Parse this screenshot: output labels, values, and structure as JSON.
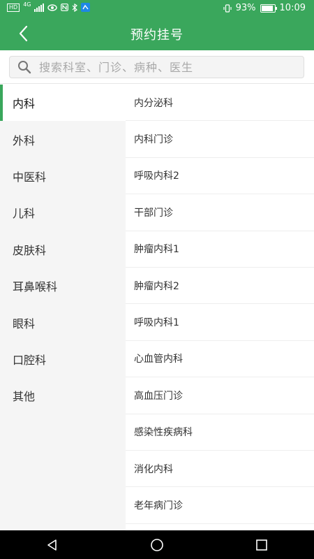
{
  "status_bar": {
    "network_badge": "HD",
    "signal_type": "4G",
    "battery_percent": "93%",
    "battery_level": 0.93,
    "time": "10:09",
    "icons": [
      "hd-icon",
      "signal-icon",
      "eye-icon",
      "nfc-icon",
      "bluetooth-icon",
      "app-icon",
      "vibrate-icon",
      "battery-icon"
    ]
  },
  "header": {
    "title": "预约挂号",
    "back_icon": "chevron-left-icon"
  },
  "search": {
    "placeholder": "搜索科室、门诊、病种、医生",
    "value": ""
  },
  "departments": [
    {
      "label": "内科",
      "active": true
    },
    {
      "label": "外科",
      "active": false
    },
    {
      "label": "中医科",
      "active": false
    },
    {
      "label": "儿科",
      "active": false
    },
    {
      "label": "皮肤科",
      "active": false
    },
    {
      "label": "耳鼻喉科",
      "active": false
    },
    {
      "label": "眼科",
      "active": false
    },
    {
      "label": "口腔科",
      "active": false
    },
    {
      "label": "其他",
      "active": false
    }
  ],
  "sub_departments": [
    "内分泌科",
    "内科门诊",
    "呼吸内科2",
    "干部门诊",
    "肿瘤内科1",
    "肿瘤内科2",
    "呼吸内科1",
    "心血管内科",
    "高血压门诊",
    "感染性疾病科",
    "消化内科",
    "老年病门诊"
  ],
  "system_nav": {
    "icons": [
      "back-triangle-icon",
      "home-circle-icon",
      "recents-square-icon"
    ]
  },
  "colors": {
    "primary": "#3aa75c",
    "sidebar_bg": "#f5f5f5",
    "nav_bar_bg": "#000000"
  }
}
